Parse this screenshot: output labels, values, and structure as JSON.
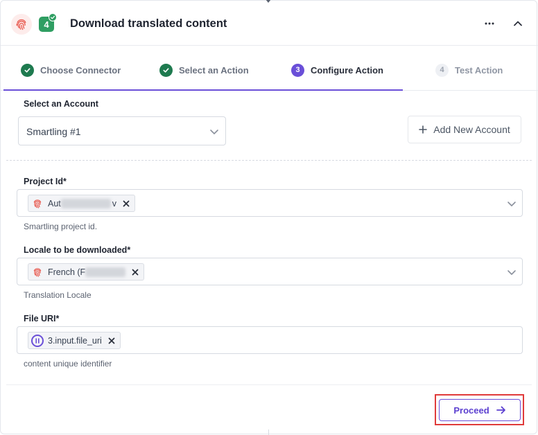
{
  "header": {
    "title": "Download translated content",
    "step_number": "4",
    "app_icon": "fingerprint-icon",
    "more_icon": "more-horizontal-icon",
    "collapse_icon": "chevron-up-icon"
  },
  "steps": [
    {
      "label": "Choose Connector",
      "state": "done",
      "marker": ""
    },
    {
      "label": "Select an Action",
      "state": "done",
      "marker": ""
    },
    {
      "label": "Configure Action",
      "state": "active",
      "marker": "3"
    },
    {
      "label": "Test Action",
      "state": "pending",
      "marker": "4"
    }
  ],
  "account": {
    "label": "Select an Account",
    "selected": "Smartling #1",
    "add_button": "Add New Account"
  },
  "fields": {
    "project": {
      "label": "Project Id*",
      "chip_text": "Aut",
      "chip_suffix": "v",
      "help": "Smartling project id."
    },
    "locale": {
      "label": "Locale to be downloaded*",
      "chip_text": "French (F",
      "help": "Translation Locale"
    },
    "file_uri": {
      "label": "File URI*",
      "chip_text": "3.input.file_uri",
      "help": "content unique identifier"
    }
  },
  "actions": {
    "proceed": "Proceed"
  },
  "colors": {
    "accent": "#6a4fd8",
    "success": "#1e7a4f",
    "brand": "#e8584d",
    "highlight": "#e03a3a"
  }
}
